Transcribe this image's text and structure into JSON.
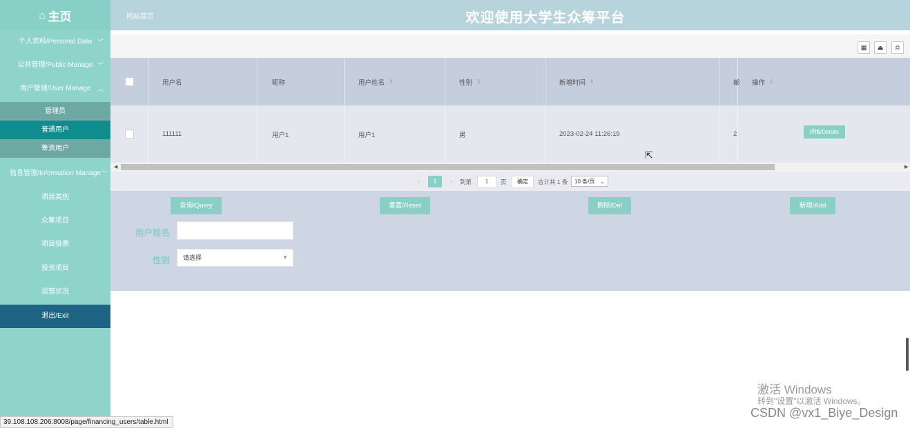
{
  "header": {
    "home_label": "主页",
    "site_link": "网站首页",
    "title": "欢迎使用大学生众筹平台"
  },
  "sidebar": {
    "menus": [
      {
        "label": "个人资料/Personal Data"
      },
      {
        "label": "公共管理/Public Manage"
      },
      {
        "label": "用户管理/User Manage"
      },
      {
        "label": "信息管理/Information Manage"
      }
    ],
    "user_sub": [
      {
        "label": "管理员"
      },
      {
        "label": "普通用户"
      },
      {
        "label": "筹资用户"
      }
    ],
    "info_sub": [
      {
        "label": "项目类别"
      },
      {
        "label": "众筹项目"
      },
      {
        "label": "项目投票"
      },
      {
        "label": "投资项目"
      },
      {
        "label": "运营状况"
      }
    ],
    "exit": "退出/Exit"
  },
  "table": {
    "columns": [
      "用户名",
      "昵称",
      "用户姓名",
      "性别",
      "新增时间",
      "邮",
      "操作"
    ],
    "rows": [
      {
        "username": "111111",
        "nickname": "用户1",
        "realname": "用户1",
        "gender": "男",
        "time": "2023-02-24 11:26:19",
        "extra": "2",
        "action": "详情/Details"
      }
    ]
  },
  "pager": {
    "page": "1",
    "goto_prefix": "到第",
    "goto_value": "1",
    "goto_suffix": "页",
    "confirm": "确定",
    "total": "合计共 1 条",
    "per_page": "10 条/页"
  },
  "actions": {
    "query": "查询/Query",
    "reset": "重置/Reset",
    "del": "删除/Del",
    "add": "新增/Add"
  },
  "form": {
    "name_label": "用户姓名",
    "gender_label": "性别",
    "gender_placeholder": "请选择"
  },
  "watermark": {
    "line1": "激活 Windows",
    "line2": "转到\"设置\"以激活 Windows。",
    "credit": "CSDN @vx1_Biye_Design"
  },
  "status_url": "39.108.108.206:8008/page/financing_users/table.html"
}
